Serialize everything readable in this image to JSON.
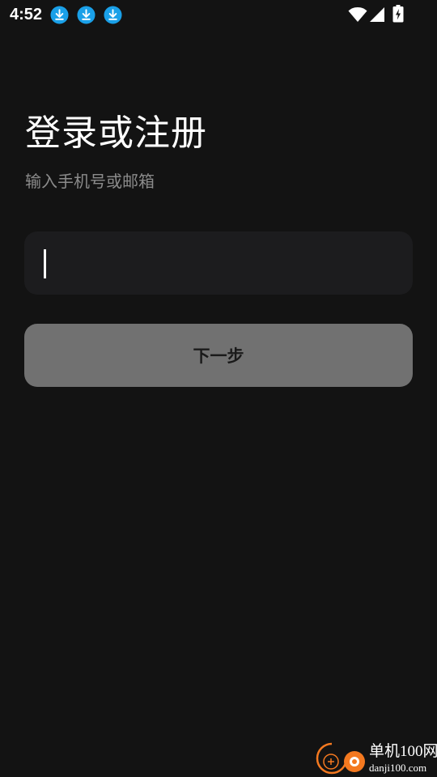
{
  "status_bar": {
    "time": "4:52",
    "notification_icons": [
      "download-icon",
      "download-icon",
      "download-icon"
    ],
    "system_icons": [
      "wifi-icon",
      "signal-icon",
      "battery-charging-icon"
    ],
    "accent_color": "#1aa0e8"
  },
  "login": {
    "title": "登录或注册",
    "subtitle": "输入手机号或邮箱",
    "input": {
      "value": "",
      "placeholder": ""
    },
    "next_label": "下一步"
  },
  "watermark": {
    "logo": "danji100-logo",
    "text": "单机100网",
    "url": "danji100.com",
    "logo_color": "#f47920"
  },
  "colors": {
    "background": "#131313",
    "input_background": "#1c1c1e",
    "button_background": "#717171",
    "subtitle_text": "#8b8b8b"
  }
}
